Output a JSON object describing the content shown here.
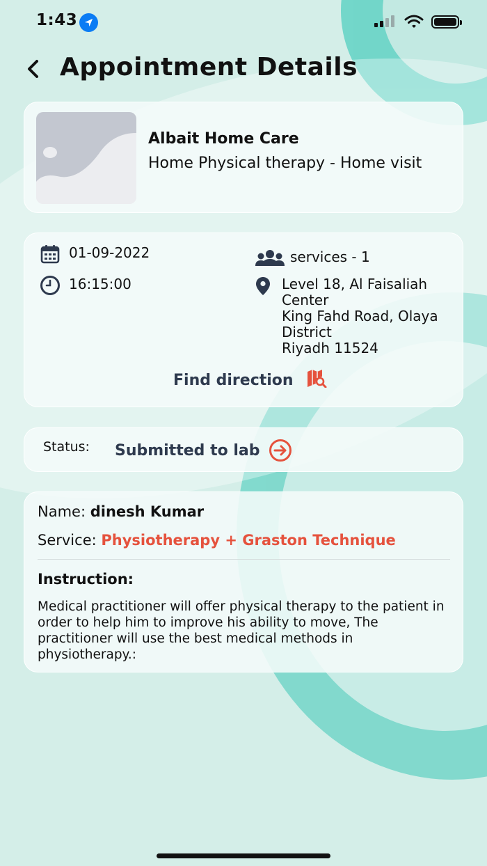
{
  "status_bar": {
    "time": "1:43"
  },
  "header": {
    "title": "Appointment Details"
  },
  "provider_card": {
    "name": "Albait Home Care",
    "service_type": "Home Physical therapy  - Home visit"
  },
  "details_card": {
    "date": "01-09-2022",
    "time": "16:15:00",
    "services": "services - 1",
    "address_lines": [
      "Level 18, Al Faisaliah",
      "Center",
      "King Fahd Road, Olaya",
      "District",
      "Riyadh 11524"
    ],
    "find_direction_label": "Find direction"
  },
  "status_card": {
    "label": "Status:",
    "value": "Submitted to lab"
  },
  "info_card": {
    "name_label": "Name:",
    "name_value": "dinesh Kumar",
    "service_label": "Service:",
    "service_value": "Physiotherapy + Graston Technique",
    "instruction_title": "Instruction:",
    "instruction_text": "Medical practitioner will offer physical therapy to the patient in order to help him to improve his ability to move, The practitioner will use the best medical methods in physiotherapy.:"
  },
  "colors": {
    "accent": "#e5523d",
    "heading_dark": "#2e3a4e",
    "background": "#d4eee8",
    "teal": "#62d2c4"
  },
  "icons": [
    "location-arrow-icon",
    "back-chevron-icon",
    "calendar-icon",
    "clock-icon",
    "users-icon",
    "map-pin-icon",
    "map-search-icon",
    "arrow-circle-right-icon"
  ]
}
